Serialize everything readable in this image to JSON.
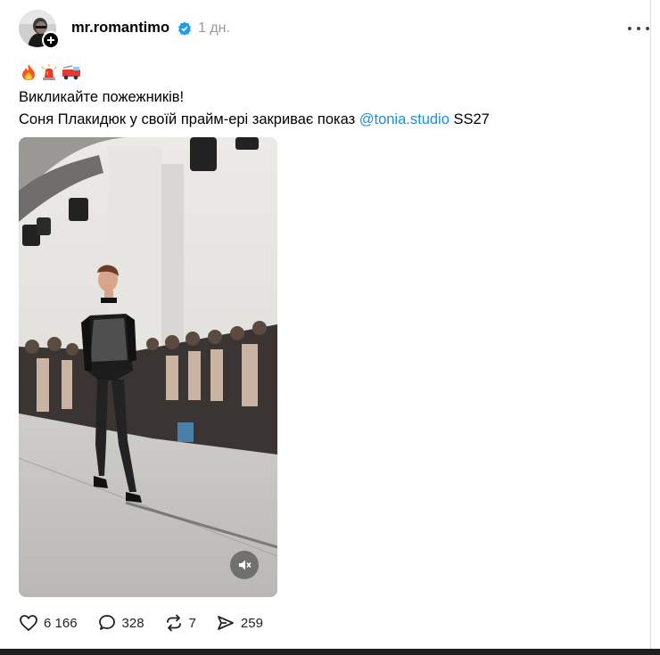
{
  "post": {
    "username": "mr.romantimo",
    "timestamp": "1 дн.",
    "line1": "Викликайте пожежників!",
    "line2_text": "Соня Плакидюк у своїй прайм-ері закриває показ ",
    "mention": "@tonia.studio",
    "line2_suffix": " SS27",
    "emojis": [
      "fire-emoji",
      "police-light-emoji",
      "fire-engine-emoji"
    ]
  },
  "actions": {
    "likes": "6 166",
    "replies": "328",
    "reposts": "7",
    "shares": "259"
  },
  "colors": {
    "mention": "#1d8fdb",
    "verified": "#1d9bf0",
    "timestamp": "#999999"
  }
}
